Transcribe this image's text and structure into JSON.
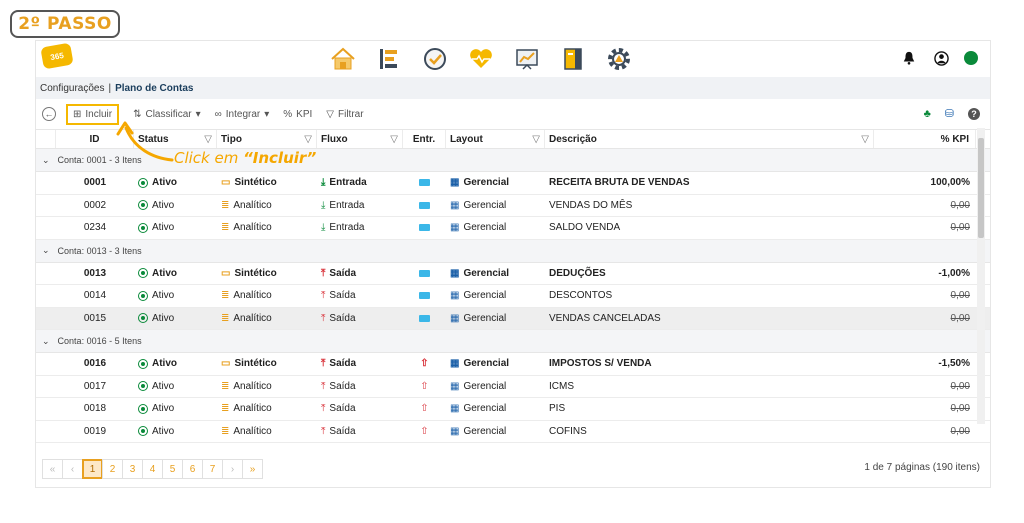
{
  "step_label": "2º PASSO",
  "logo_text": "365",
  "modules": [
    "home-icon",
    "structure-icon",
    "check-icon",
    "heart-icon",
    "chart-icon",
    "notebook-icon",
    "gear-icon"
  ],
  "breadcrumb": {
    "parent": "Configurações",
    "separator": "|",
    "current": "Plano de Contas"
  },
  "toolbar": {
    "incluir": "Incluir",
    "classificar": "Classificar",
    "integrar": "Integrar",
    "kpi": "KPI",
    "filtrar": "Filtrar"
  },
  "columns": {
    "id": "ID",
    "status": "Status",
    "tipo": "Tipo",
    "fluxo": "Fluxo",
    "entr": "Entr.",
    "layout": "Layout",
    "descricao": "Descrição",
    "kpi": "% KPI"
  },
  "groups": [
    {
      "label": "Conta: 0001 - 3 Itens",
      "rows": [
        {
          "id": "0001",
          "status": "Ativo",
          "tipo": "Sintético",
          "fluxo": "Entrada",
          "flow": "in",
          "entr": true,
          "layout": "Gerencial",
          "descricao": "RECEITA BRUTA DE VENDAS",
          "kpi": "100,00%",
          "bold": true,
          "zero": false
        },
        {
          "id": "0002",
          "status": "Ativo",
          "tipo": "Analítico",
          "fluxo": "Entrada",
          "flow": "in",
          "entr": true,
          "layout": "Gerencial",
          "descricao": "VENDAS DO MÊS",
          "kpi": "0,00",
          "bold": false,
          "zero": true
        },
        {
          "id": "0234",
          "status": "Ativo",
          "tipo": "Analítico",
          "fluxo": "Entrada",
          "flow": "in",
          "entr": true,
          "layout": "Gerencial",
          "descricao": "SALDO VENDA",
          "kpi": "0,00",
          "bold": false,
          "zero": true
        }
      ]
    },
    {
      "label": "Conta: 0013 - 3 Itens",
      "rows": [
        {
          "id": "0013",
          "status": "Ativo",
          "tipo": "Sintético",
          "fluxo": "Saída",
          "flow": "out",
          "entr": true,
          "layout": "Gerencial",
          "descricao": "DEDUÇÕES",
          "kpi": "-1,00%",
          "bold": true,
          "zero": false
        },
        {
          "id": "0014",
          "status": "Ativo",
          "tipo": "Analítico",
          "fluxo": "Saída",
          "flow": "out",
          "entr": true,
          "layout": "Gerencial",
          "descricao": "DESCONTOS",
          "kpi": "0,00",
          "bold": false,
          "zero": true
        },
        {
          "id": "0015",
          "status": "Ativo",
          "tipo": "Analítico",
          "fluxo": "Saída",
          "flow": "out",
          "entr": true,
          "layout": "Gerencial",
          "descricao": "VENDAS CANCELADAS",
          "kpi": "0,00",
          "bold": false,
          "zero": true,
          "highlight": true
        }
      ]
    },
    {
      "label": "Conta: 0016 - 5 Itens",
      "rows": [
        {
          "id": "0016",
          "status": "Ativo",
          "tipo": "Sintético",
          "fluxo": "Saída",
          "flow": "out",
          "entr": false,
          "layout": "Gerencial",
          "descricao": "IMPOSTOS S/ VENDA",
          "kpi": "-1,50%",
          "bold": true,
          "zero": false
        },
        {
          "id": "0017",
          "status": "Ativo",
          "tipo": "Analítico",
          "fluxo": "Saída",
          "flow": "out",
          "entr": false,
          "layout": "Gerencial",
          "descricao": "ICMS",
          "kpi": "0,00",
          "bold": false,
          "zero": true
        },
        {
          "id": "0018",
          "status": "Ativo",
          "tipo": "Analítico",
          "fluxo": "Saída",
          "flow": "out",
          "entr": false,
          "layout": "Gerencial",
          "descricao": "PIS",
          "kpi": "0,00",
          "bold": false,
          "zero": true
        },
        {
          "id": "0019",
          "status": "Ativo",
          "tipo": "Analítico",
          "fluxo": "Saída",
          "flow": "out",
          "entr": false,
          "layout": "Gerencial",
          "descricao": "COFINS",
          "kpi": "0,00",
          "bold": false,
          "zero": true
        }
      ]
    }
  ],
  "pagination": {
    "first": "«",
    "prev": "‹",
    "pages": [
      "1",
      "2",
      "3",
      "4",
      "5",
      "6",
      "7"
    ],
    "current": "1",
    "next": "›",
    "last": "»",
    "info": "1 de 7 páginas (190 itens)"
  },
  "callout": {
    "prefix": "Click em ",
    "target": "“Incluir”"
  },
  "colors": {
    "accent": "#f5b800",
    "active_green": "#0a8a3a",
    "outflow_red": "#d9363e",
    "layout_blue": "#1a5fa8",
    "breadcrumb_bg": "#f0f2f5"
  }
}
